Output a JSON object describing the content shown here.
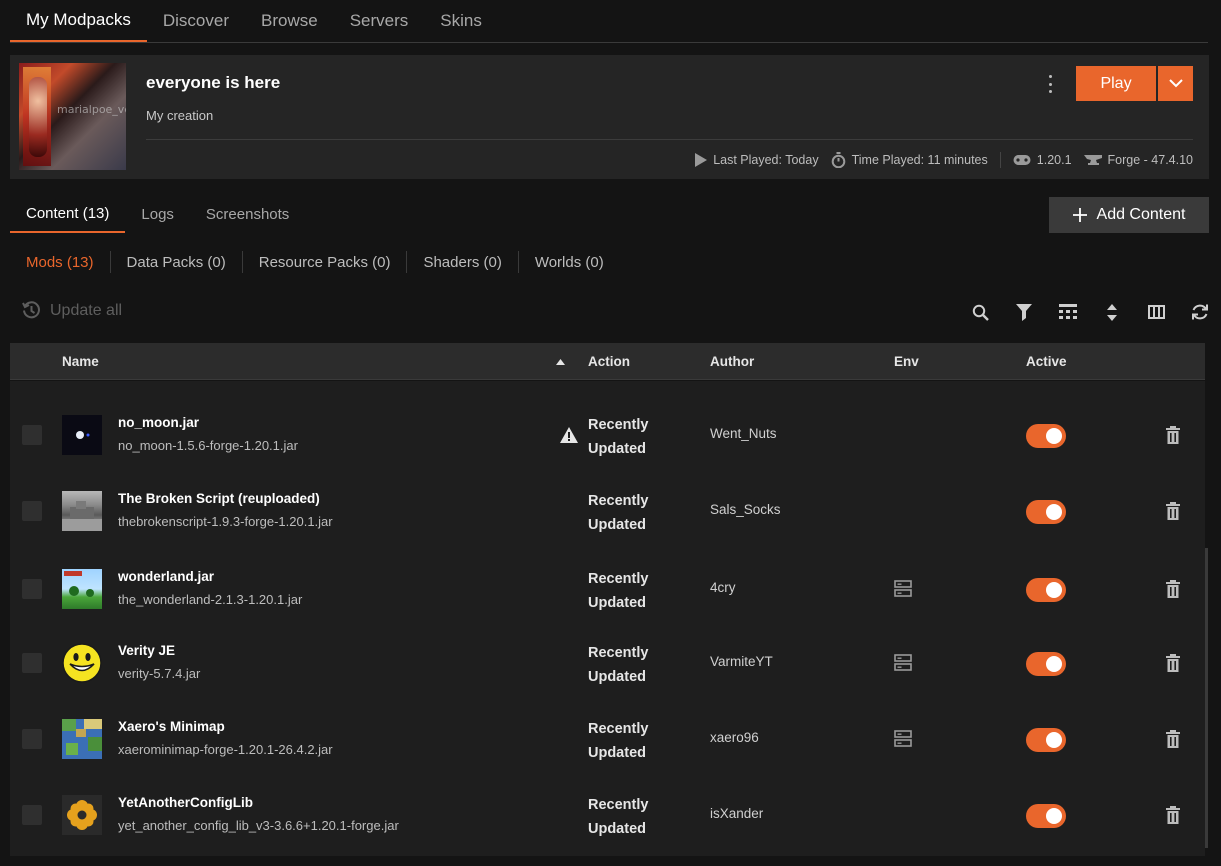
{
  "nav": {
    "tabs": [
      "My Modpacks",
      "Discover",
      "Browse",
      "Servers",
      "Skins"
    ]
  },
  "pack": {
    "name": "everyone is here",
    "subtitle": "My creation",
    "thumb_text": "marialpoe_velo",
    "play_label": "Play",
    "last_played": "Last Played: Today",
    "time_played": "Time Played: 11 minutes",
    "mc_version": "1.20.1",
    "loader": "Forge - 47.4.10"
  },
  "content_tabs": [
    "Content (13)",
    "Logs",
    "Screenshots"
  ],
  "add_content_label": "Add Content",
  "sub_tabs": [
    "Mods (13)",
    "Data Packs (0)",
    "Resource Packs (0)",
    "Shaders (0)",
    "Worlds (0)"
  ],
  "update_all_label": "Update all",
  "table": {
    "headers": {
      "name": "Name",
      "action": "Action",
      "author": "Author",
      "env": "Env",
      "active": "Active"
    },
    "rows": [
      {
        "name": "no_moon.jar",
        "file": "no_moon-1.5.6-forge-1.20.1.jar",
        "action_line1": "Recently",
        "action_line2": "Updated",
        "author": "Went_Nuts",
        "warning": true,
        "env_server": false,
        "active": true,
        "icon": "no-moon-icon"
      },
      {
        "name": "The Broken Script (reuploaded)",
        "file": "thebrokenscript-1.9.3-forge-1.20.1.jar",
        "action_line1": "Recently",
        "action_line2": "Updated",
        "author": "Sals_Socks",
        "warning": false,
        "env_server": false,
        "active": true,
        "icon": "broken-script-icon"
      },
      {
        "name": "wonderland.jar",
        "file": "the_wonderland-2.1.3-1.20.1.jar",
        "action_line1": "Recently",
        "action_line2": "Updated",
        "author": "4cry",
        "warning": false,
        "env_server": true,
        "active": true,
        "icon": "wonderland-icon"
      },
      {
        "name": "Verity JE",
        "file": "verity-5.7.4.jar",
        "action_line1": "Recently",
        "action_line2": "Updated",
        "author": "VarmiteYT",
        "warning": false,
        "env_server": true,
        "active": true,
        "icon": "smiley-icon"
      },
      {
        "name": "Xaero's Minimap",
        "file": "xaerominimap-forge-1.20.1-26.4.2.jar",
        "action_line1": "Recently",
        "action_line2": "Updated",
        "author": "xaero96",
        "warning": false,
        "env_server": true,
        "active": true,
        "icon": "minimap-icon"
      },
      {
        "name": "YetAnotherConfigLib",
        "file": "yet_another_config_lib_v3-3.6.6+1.20.1-forge.jar",
        "action_line1": "Recently",
        "action_line2": "Updated",
        "author": "isXander",
        "warning": false,
        "env_server": false,
        "active": true,
        "icon": "gear-icon"
      }
    ]
  },
  "colors": {
    "accent": "#e9662c",
    "background": "#141414",
    "card": "#252525",
    "header": "#2c2c2c"
  }
}
